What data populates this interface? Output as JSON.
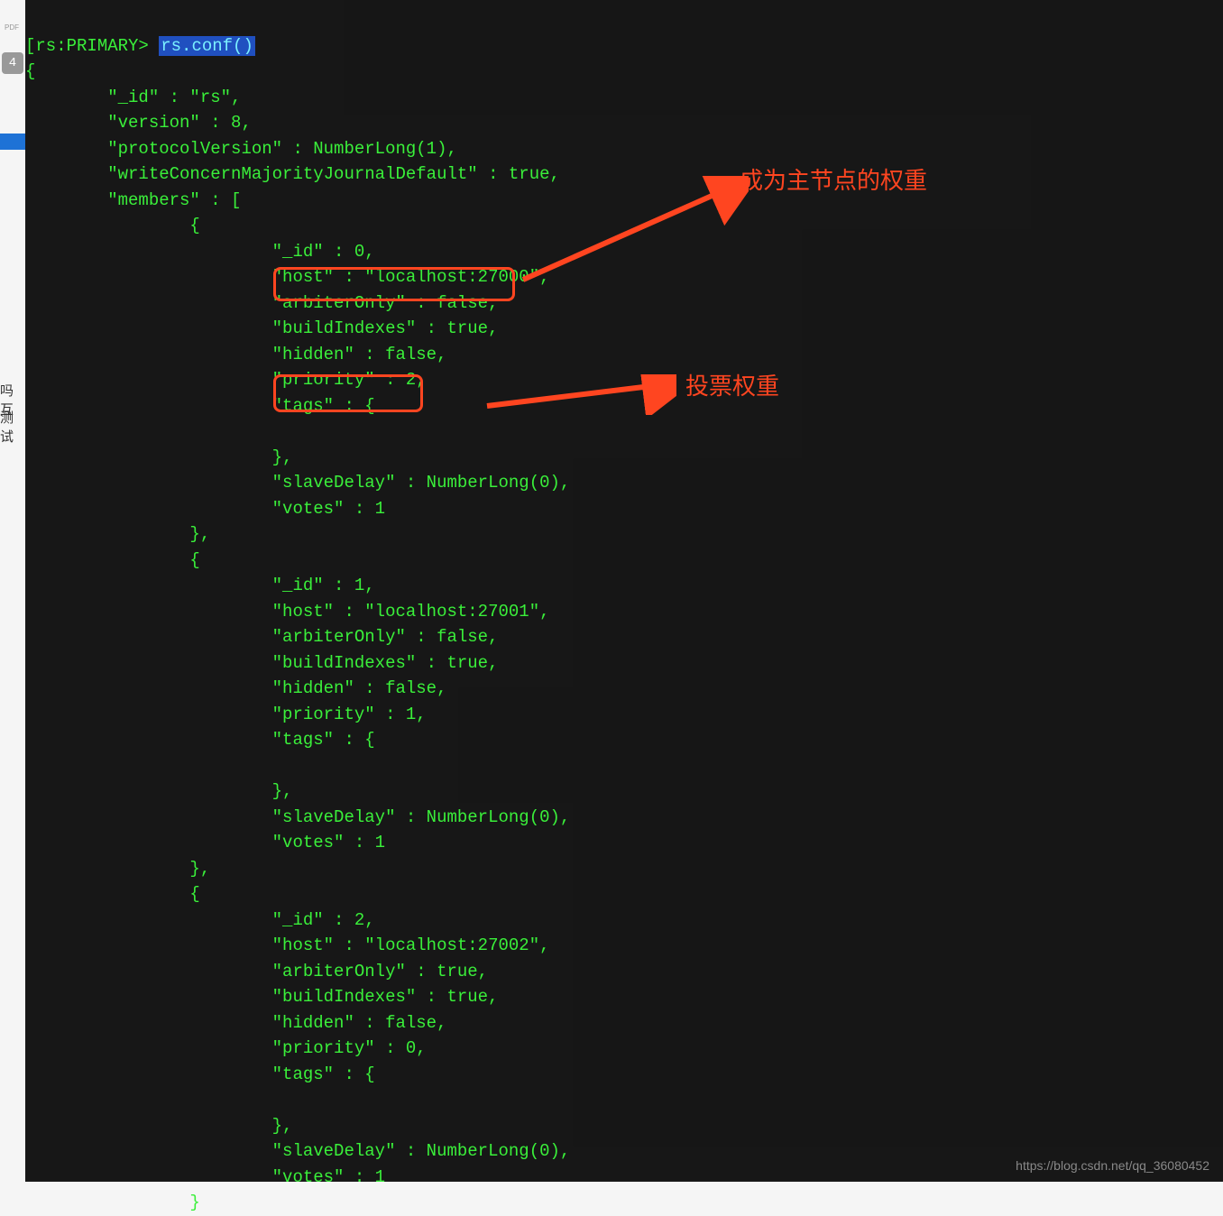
{
  "sidebar": {
    "pdf_label": "PDF",
    "badge": "4",
    "text1": "吗互",
    "text2": "测试"
  },
  "terminal": {
    "prompt_prefix": "[",
    "prompt": "rs:PRIMARY>",
    "command": "rs.conf()",
    "config": {
      "opening_brace": "{",
      "line_id": "        \"_id\" : \"rs\",",
      "line_version": "        \"version\" : 8,",
      "line_protocol": "        \"protocolVersion\" : NumberLong(1),",
      "line_writeconcern": "        \"writeConcernMajorityJournalDefault\" : true,",
      "line_members": "        \"members\" : [",
      "member0_open": "                {",
      "member0_id": "                        \"_id\" : 0,",
      "member0_host": "                        \"host\" : \"localhost:27000\",",
      "member0_arbiter": "                        \"arbiterOnly\" : false,",
      "member0_build": "                        \"buildIndexes\" : true,",
      "member0_hidden": "                        \"hidden\" : false,",
      "member0_priority": "                        \"priority\" : 2,",
      "member0_tags": "                        \"tags\" : {",
      "member0_tags_empty": "",
      "member0_tags_close": "                        },",
      "member0_slavedelay": "                        \"slaveDelay\" : NumberLong(0),",
      "member0_votes": "                        \"votes\" : 1",
      "member0_close": "                },",
      "member1_open": "                {",
      "member1_id": "                        \"_id\" : 1,",
      "member1_host": "                        \"host\" : \"localhost:27001\",",
      "member1_arbiter": "                        \"arbiterOnly\" : false,",
      "member1_build": "                        \"buildIndexes\" : true,",
      "member1_hidden": "                        \"hidden\" : false,",
      "member1_priority": "                        \"priority\" : 1,",
      "member1_tags": "                        \"tags\" : {",
      "member1_tags_empty": "",
      "member1_tags_close": "                        },",
      "member1_slavedelay": "                        \"slaveDelay\" : NumberLong(0),",
      "member1_votes": "                        \"votes\" : 1",
      "member1_close": "                },",
      "member2_open": "                {",
      "member2_id": "                        \"_id\" : 2,",
      "member2_host": "                        \"host\" : \"localhost:27002\",",
      "member2_arbiter": "                        \"arbiterOnly\" : true,",
      "member2_build": "                        \"buildIndexes\" : true,",
      "member2_hidden": "                        \"hidden\" : false,",
      "member2_priority": "                        \"priority\" : 0,",
      "member2_tags": "                        \"tags\" : {",
      "member2_tags_empty": "",
      "member2_tags_close": "                        },",
      "member2_slavedelay": "                        \"slaveDelay\" : NumberLong(0),",
      "member2_votes": "                        \"votes\" : 1",
      "member2_close": "                }"
    }
  },
  "annotations": {
    "priority_label": "成为主节点的权重",
    "votes_label": "投票权重"
  },
  "watermark": "https://blog.csdn.net/qq_36080452"
}
